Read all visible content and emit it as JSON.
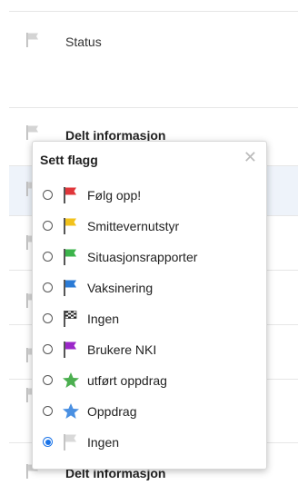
{
  "list": {
    "rows": [
      {
        "label": "Status"
      },
      {
        "label": "Delt informasjon"
      },
      {
        "label": ""
      },
      {
        "label": ""
      },
      {
        "label": ""
      },
      {
        "label": ""
      },
      {
        "label": ""
      },
      {
        "label": "Delt informasjon"
      }
    ]
  },
  "popup": {
    "title": "Sett flagg",
    "close_glyph": "✕",
    "options": [
      {
        "label": "Følg opp!",
        "icon": "red-flag-icon",
        "color": "#e0363a",
        "selected": false
      },
      {
        "label": "Smittevernutstyr",
        "icon": "yellow-flag-icon",
        "color": "#f2c21b",
        "selected": false
      },
      {
        "label": "Situasjonsrapporter",
        "icon": "green-flag-icon",
        "color": "#3cb44b",
        "selected": false
      },
      {
        "label": "Vaksinering",
        "icon": "blue-flag-icon",
        "color": "#2b7bd6",
        "selected": false
      },
      {
        "label": "Ingen",
        "icon": "checkered-flag-icon",
        "color": "#222222",
        "selected": false
      },
      {
        "label": "Brukere NKI",
        "icon": "purple-flag-icon",
        "color": "#9b27c9",
        "selected": false
      },
      {
        "label": "utført oppdrag",
        "icon": "green-star-icon",
        "color": "#4caf50",
        "selected": false
      },
      {
        "label": "Oppdrag",
        "icon": "blue-star-icon",
        "color": "#4a90e2",
        "selected": false
      },
      {
        "label": "Ingen",
        "icon": "gray-flag-icon",
        "color": "#cfcfcf",
        "selected": true
      }
    ]
  }
}
